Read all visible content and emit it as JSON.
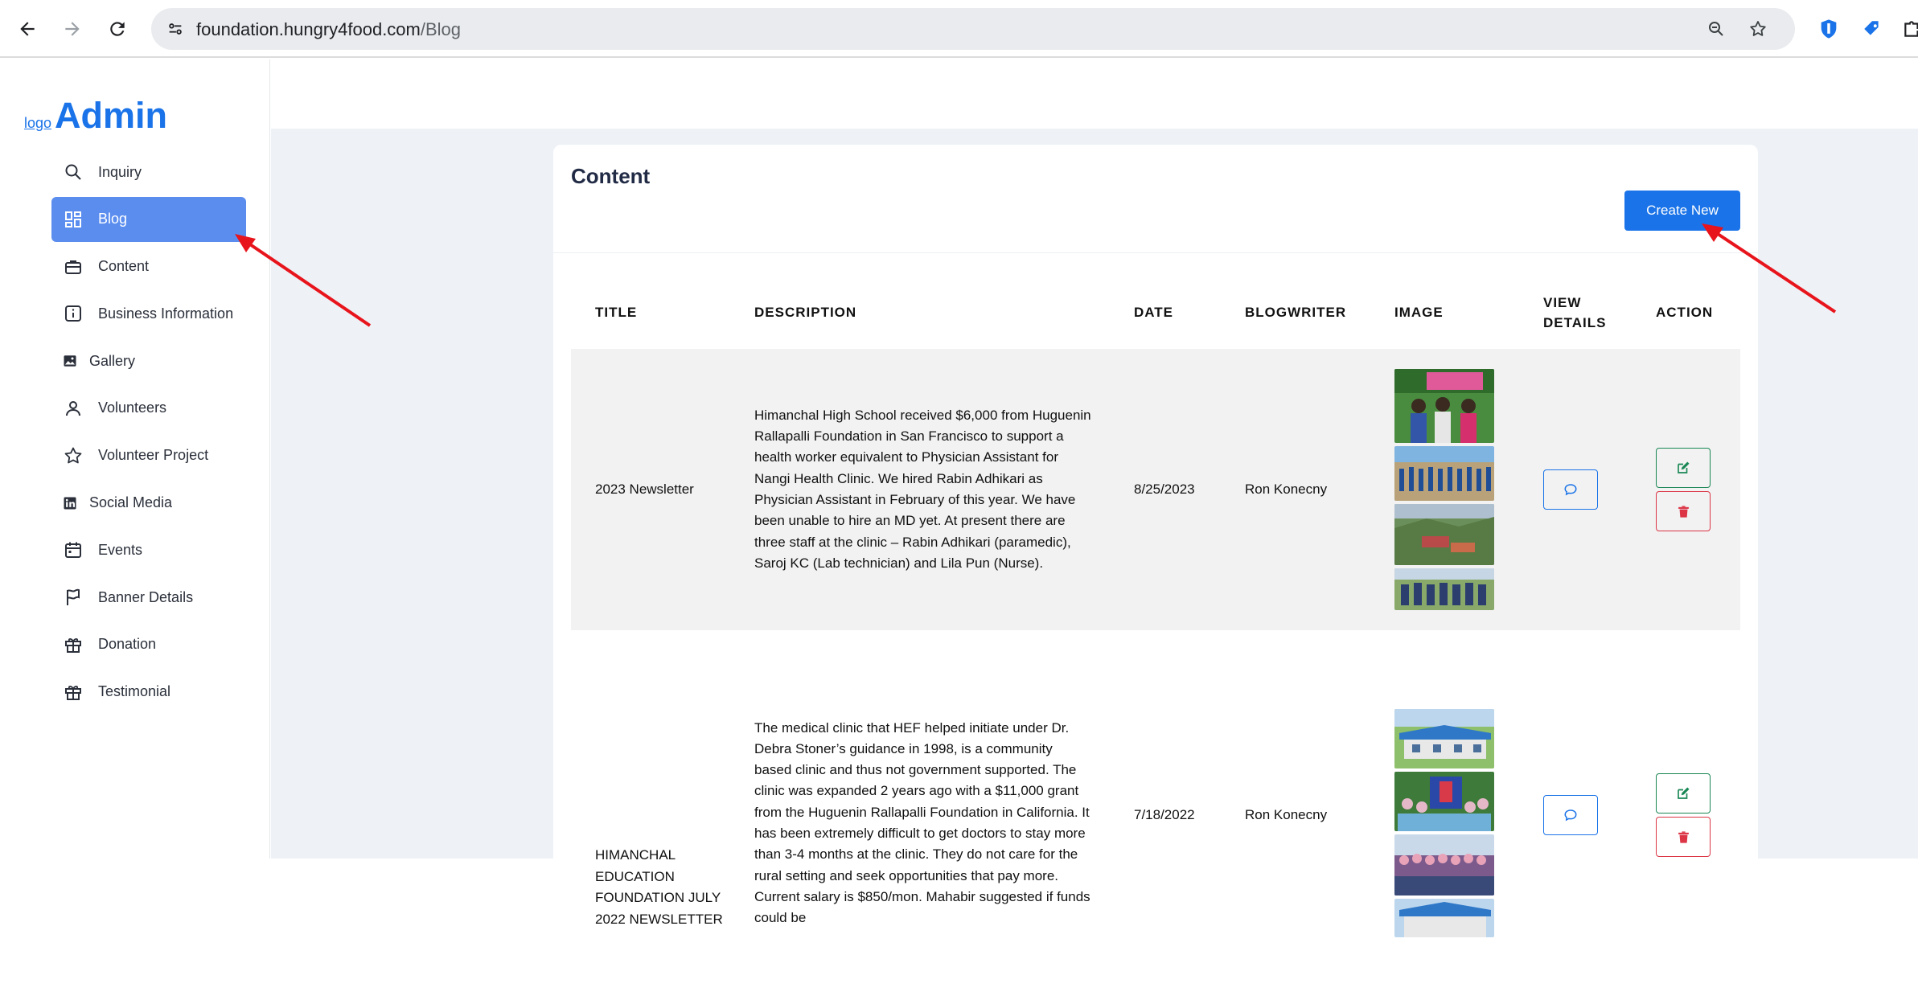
{
  "browser": {
    "url_host": "foundation.hungry4food.com",
    "url_path": "/Blog"
  },
  "sidebar": {
    "logo_alt": "logo",
    "brand": "Admin",
    "items": [
      {
        "label": "Inquiry",
        "icon": "search-icon"
      },
      {
        "label": "Blog",
        "icon": "dashboard-icon",
        "active": true
      },
      {
        "label": "Content",
        "icon": "briefcase-icon"
      },
      {
        "label": "Business Information",
        "icon": "info-icon"
      },
      {
        "label": "Gallery",
        "icon": "image-icon"
      },
      {
        "label": "Volunteers",
        "icon": "user-icon"
      },
      {
        "label": "Volunteer Project",
        "icon": "star-icon"
      },
      {
        "label": "Social Media",
        "icon": "linkedin-icon"
      },
      {
        "label": "Events",
        "icon": "calendar-icon"
      },
      {
        "label": "Banner Details",
        "icon": "flag-icon"
      },
      {
        "label": "Donation",
        "icon": "gift-icon"
      },
      {
        "label": "Testimonial",
        "icon": "gift-icon"
      }
    ]
  },
  "main": {
    "title": "Content",
    "create_button": "Create New",
    "columns": [
      "TITLE",
      "DESCRIPTION",
      "DATE",
      "BLOGWRITER",
      "IMAGE",
      "VIEW\nDETAILS",
      "ACTION"
    ],
    "rows": [
      {
        "title": "2023 Newsletter",
        "description": "Himanchal High School received $6,000 from Huguenin Rallapalli Foundation in San Francisco to support a health worker equivalent to Physician Assistant for Nangi Health Clinic. We hired Rabin Adhikari as Physician Assistant in February of this year. We have been unable to hire an MD yet. At present there are three staff at the clinic – Rabin Adhikari (paramedic), Saroj KC (Lab technician) and Lila Pun (Nurse).",
        "date": "8/25/2023",
        "writer": "Ron Konecny"
      },
      {
        "title": "HIMANCHAL EDUCATION FOUNDATION JULY 2022 NEWSLETTER",
        "description": "The medical clinic that HEF helped initiate under Dr. Debra Stoner’s guidance in 1998, is a community based clinic and thus not government supported. The clinic was expanded 2 years ago with a $11,000 grant from the Huguenin Rallapalli Foundation in California. It has been extremely difficult to get doctors to stay more than 3-4 months at the clinic. They do not care for the rural setting and seek opportunities that pay more. Current salary is $850/mon. Mahabir suggested if funds could be",
        "date": "7/18/2022",
        "writer": "Ron Konecny"
      }
    ]
  },
  "colors": {
    "accent": "#1a73e8",
    "sidebar_active": "#5b8def",
    "annotation_arrow": "#e8141c"
  }
}
